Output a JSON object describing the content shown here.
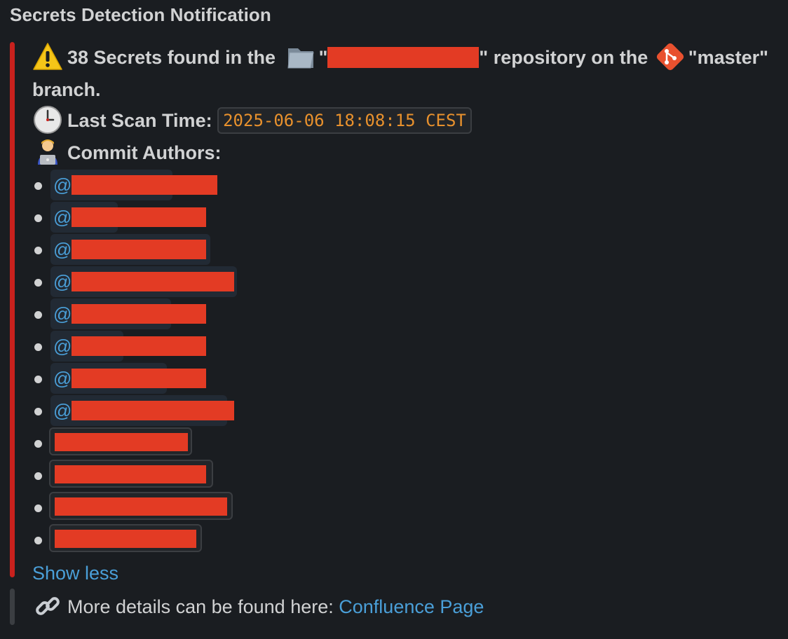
{
  "title": "Secrets Detection Notification",
  "summary": {
    "count_text": "38 Secrets found in the",
    "quote_open": "\"",
    "quote_close": "\"",
    "repo_suffix": "repository on the",
    "branch_name": "\"master\"",
    "branch_word": "branch."
  },
  "scan": {
    "label": "Last Scan Time:",
    "time": "2025-06-06 18:08:15 CEST"
  },
  "authors": {
    "label": "Commit Authors:",
    "mention_prefix": "@"
  },
  "show_less": "Show less",
  "details": {
    "text": "More details can be found here:",
    "link_label": "Confluence Page"
  },
  "colors": {
    "danger_bar": "#c8211d",
    "neutral_bar": "#3b3e42",
    "link": "#4a9fd8",
    "code_text": "#e8912d",
    "redaction": "#e33b24"
  },
  "icons": [
    "warning-icon",
    "folder-icon",
    "git-branch-icon",
    "clock-icon",
    "technologist-icon",
    "link-icon"
  ]
}
